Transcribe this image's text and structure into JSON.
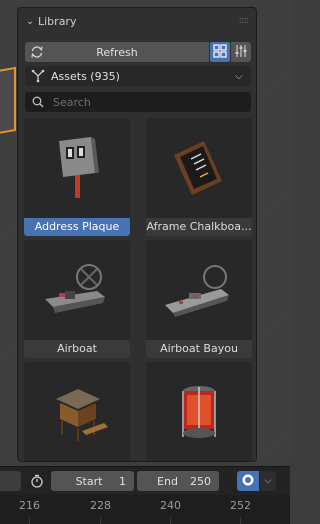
{
  "panel": {
    "title": "Library",
    "refresh_label": "Refresh",
    "asset_library": "Assets (935)",
    "search_placeholder": "Search",
    "icons": {
      "collapse": "chevron-down-icon",
      "refresh": "refresh-icon",
      "view_mode": "grid-view-icon",
      "filter": "filter-settings-icon",
      "library": "asset-library-icon",
      "search": "search-icon"
    },
    "assets": [
      {
        "label": "Address Plaque",
        "selected": true
      },
      {
        "label": "Aframe Chalkboa...",
        "selected": false
      },
      {
        "label": "Airboat",
        "selected": false
      },
      {
        "label": "Airboat Bayou",
        "selected": false
      },
      {
        "label": "",
        "selected": false
      },
      {
        "label": "",
        "selected": false
      }
    ]
  },
  "timeline": {
    "start_label": "Start",
    "start_value": "1",
    "end_label": "End",
    "end_value": "250",
    "ruler_ticks": [
      "216",
      "228",
      "240",
      "252"
    ]
  },
  "colors": {
    "accent": "#4772b3",
    "panel": "#303030",
    "highlight": "#e8912e"
  }
}
